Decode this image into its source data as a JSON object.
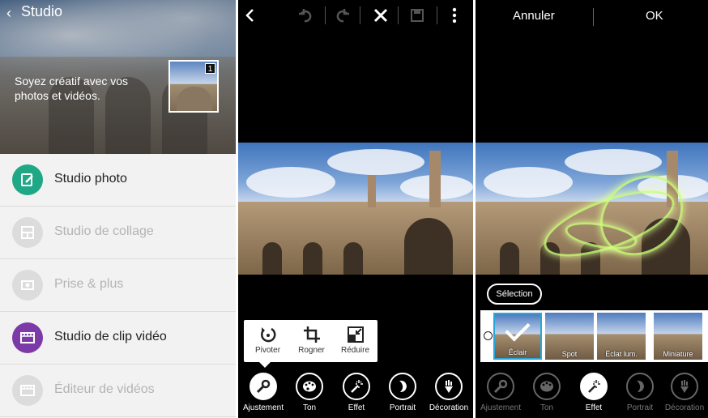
{
  "panel1": {
    "title": "Studio",
    "tagline": "Soyez créatif avec vos photos et vidéos.",
    "thumb_badge": "1",
    "menu": [
      {
        "label": "Studio photo",
        "icon": "photo-edit-icon",
        "enabled": true,
        "color": "#1fa886"
      },
      {
        "label": "Studio de collage",
        "icon": "collage-icon",
        "enabled": false
      },
      {
        "label": "Prise & plus",
        "icon": "camera-icon",
        "enabled": false
      },
      {
        "label": "Studio de clip vidéo",
        "icon": "video-clip-icon",
        "enabled": true,
        "color": "#7c3aa8"
      },
      {
        "label": "Éditeur de vidéos",
        "icon": "video-editor-icon",
        "enabled": false
      }
    ]
  },
  "panel2": {
    "toolbar": [
      "back-icon",
      "undo-icon",
      "redo-icon",
      "close-icon",
      "save-icon",
      "more-icon"
    ],
    "tools": [
      {
        "label": "Pivoter",
        "icon": "rotate-icon"
      },
      {
        "label": "Rogner",
        "icon": "crop-icon"
      },
      {
        "label": "Réduire",
        "icon": "resize-icon"
      }
    ],
    "tabs": [
      {
        "label": "Ajustement",
        "icon": "wrench-icon",
        "selected": true
      },
      {
        "label": "Ton",
        "icon": "palette-icon"
      },
      {
        "label": "Effet",
        "icon": "magic-wand-icon"
      },
      {
        "label": "Portrait",
        "icon": "portrait-icon"
      },
      {
        "label": "Décoration",
        "icon": "decoration-icon"
      }
    ]
  },
  "panel3": {
    "cancel": "Annuler",
    "ok": "OK",
    "selection": "Sélection",
    "effects": [
      {
        "label": "Éclair",
        "selected": true
      },
      {
        "label": "Spot"
      },
      {
        "label": "Éclat lum."
      },
      {
        "label": "Miniature"
      }
    ],
    "tabs": [
      {
        "label": "Ajustement",
        "icon": "wrench-icon"
      },
      {
        "label": "Ton",
        "icon": "palette-icon"
      },
      {
        "label": "Effet",
        "icon": "magic-wand-icon",
        "selected": true
      },
      {
        "label": "Portrait",
        "icon": "portrait-icon"
      },
      {
        "label": "Décoration",
        "icon": "decoration-icon"
      }
    ]
  },
  "colors": {
    "accent_blue": "#2aa7d8",
    "green": "#1fa886",
    "purple": "#7c3aa8"
  }
}
